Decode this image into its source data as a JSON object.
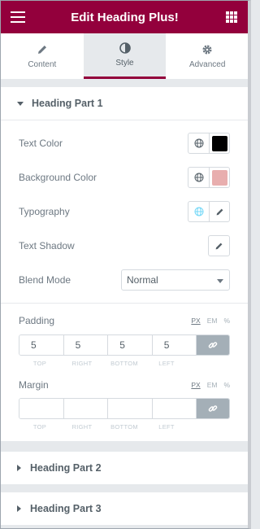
{
  "header": {
    "title": "Edit Heading Plus!"
  },
  "tabs": [
    {
      "label": "Content",
      "icon": "pencil-icon"
    },
    {
      "label": "Style",
      "icon": "contrast-icon",
      "active": true
    },
    {
      "label": "Advanced",
      "icon": "gear-icon"
    }
  ],
  "sections": {
    "part1": "Heading Part 1",
    "part2": "Heading Part 2",
    "part3": "Heading Part 3"
  },
  "controls": {
    "text_color": {
      "label": "Text Color",
      "color": "#000000"
    },
    "background_color": {
      "label": "Background Color",
      "color": "#e8aeae"
    },
    "typography": {
      "label": "Typography"
    },
    "text_shadow": {
      "label": "Text Shadow"
    },
    "blend_mode": {
      "label": "Blend Mode",
      "value": "Normal"
    }
  },
  "padding": {
    "label": "Padding",
    "units": [
      "PX",
      "EM",
      "%"
    ],
    "active_unit": "PX",
    "values": [
      "5",
      "5",
      "5",
      "5"
    ],
    "sides": [
      "TOP",
      "RIGHT",
      "BOTTOM",
      "LEFT"
    ]
  },
  "margin": {
    "label": "Margin",
    "units": [
      "PX",
      "EM",
      "%"
    ],
    "active_unit": "PX",
    "values": [
      "",
      "",
      "",
      ""
    ],
    "sides": [
      "TOP",
      "RIGHT",
      "BOTTOM",
      "LEFT"
    ]
  },
  "colors": {
    "brand": "#93003c",
    "link_bg": "#a4afb7",
    "globe_active": "#71d7f7"
  }
}
